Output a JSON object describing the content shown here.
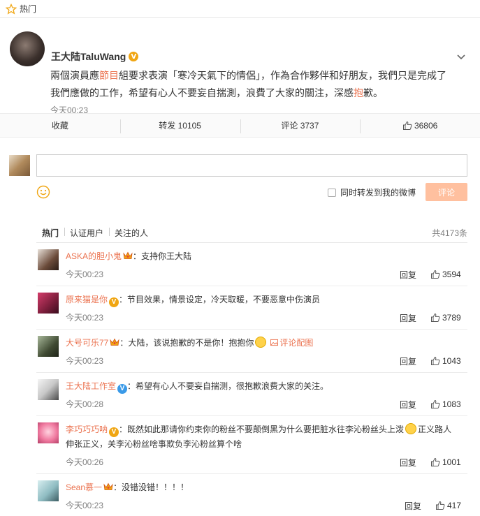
{
  "topbar": {
    "label": "热门",
    "icon": "star-icon"
  },
  "post": {
    "author": "王大陆TaluWang",
    "verified_mark": "V",
    "text_before": "兩個演員應",
    "text_hl1": "節目",
    "text_mid": "組要求表演「寒冷天氣下的情侶」，作為合作夥伴和好朋友，我們只是完成了我們應做的工作，希望有心人不要妄自揣測，浪費了大家的關注，深感",
    "text_hl2": "抱",
    "text_end": "歉。",
    "time": "今天00:23"
  },
  "actions": {
    "favorite": "收藏",
    "repost": "转发 10105",
    "comment": "评论 3737",
    "like": "36806"
  },
  "composer": {
    "repost_option": "同时转发到我的微博",
    "submit": "评论"
  },
  "filters": {
    "tabs": [
      "热门",
      "认证用户",
      "关注的人"
    ],
    "total": "共4173条"
  },
  "comments": [
    {
      "user": "ASKA的胆小鬼",
      "badge": "crown",
      "text": "：支持你王大陆",
      "time": "今天00:23",
      "reply": "回复",
      "likes": "3594"
    },
    {
      "user": "原来猫是你",
      "badge": "v-gold",
      "text": "：节目效果，情景设定，冷天取暖，不要恶意中伤演员",
      "time": "今天00:23",
      "reply": "回复",
      "likes": "3789"
    },
    {
      "user": "大号可乐77",
      "badge": "crown",
      "text": "：大陆，该说抱歉的不是你！抱抱你",
      "link": "评论配图",
      "time": "今天00:23",
      "reply": "回复",
      "likes": "1043"
    },
    {
      "user": "王大陆工作室",
      "badge": "v-blue",
      "text": "：希望有心人不要妄自揣测，很抱歉浪费大家的关注。",
      "time": "今天00:28",
      "reply": "回复",
      "likes": "1083"
    },
    {
      "user": "李巧巧巧呐",
      "badge": "v-gold",
      "text": "：既然如此那请你约束你的粉丝不要颠倒黑为什么要把脏水往李沁粉丝头上泼",
      "text2": "正义路人伸张正义，关李沁粉丝啥事欺负李沁粉丝算个啥",
      "time": "今天00:26",
      "reply": "回复",
      "likes": "1001"
    },
    {
      "user": "Sean慕一",
      "badge": "crown",
      "text": "：没错没错！！！！",
      "time": "今天00:23",
      "reply": "回复",
      "likes": "417"
    }
  ],
  "colors": {
    "accent": "#eb7350",
    "submit_bg": "#ffc09f",
    "badge_gold": "#f0a613",
    "badge_blue": "#3a9ae8"
  }
}
